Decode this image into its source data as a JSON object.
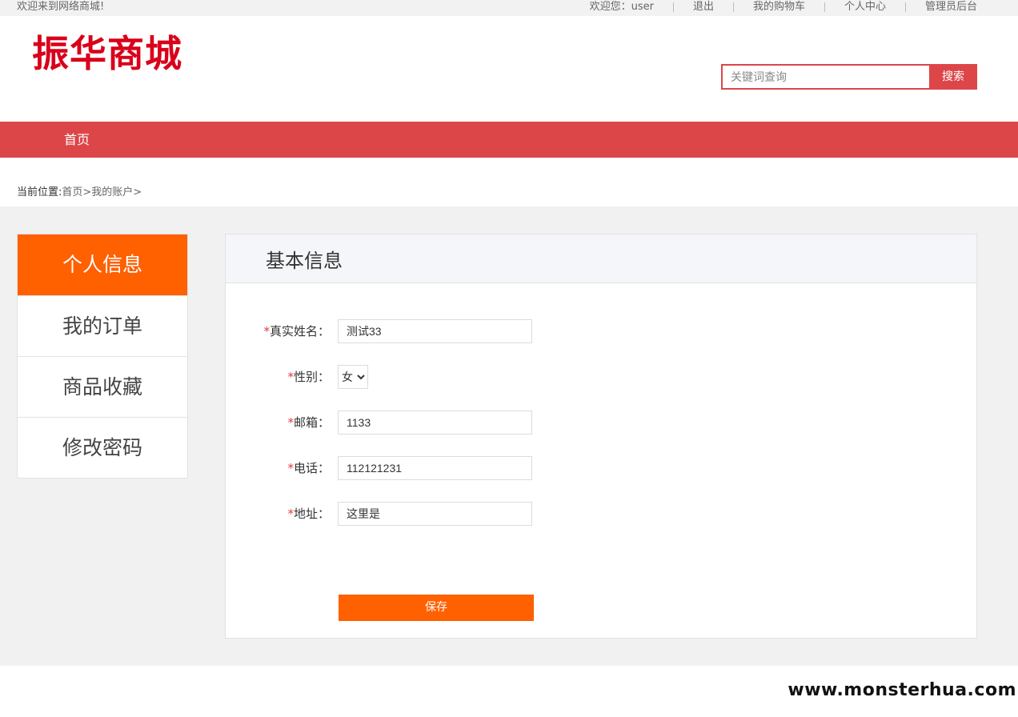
{
  "topbar": {
    "welcome": "欢迎来到网络商城!",
    "links": [
      "欢迎您：user",
      "退出",
      "我的购物车",
      "个人中心",
      "管理员后台"
    ]
  },
  "header": {
    "logo": "振华商城",
    "search_placeholder": "关键词查询",
    "search_button": "搜索"
  },
  "nav": {
    "items": [
      "首页"
    ]
  },
  "breadcrumb": {
    "label": "当前位置:",
    "path": "首页>我的账户>"
  },
  "sidebar": {
    "items": [
      {
        "label": "个人信息",
        "active": true
      },
      {
        "label": "我的订单",
        "active": false
      },
      {
        "label": "商品收藏",
        "active": false
      },
      {
        "label": "修改密码",
        "active": false
      }
    ]
  },
  "panel": {
    "title": "基本信息",
    "required_mark": "*",
    "fields": {
      "name": {
        "label": "真实姓名：",
        "value": "测试33"
      },
      "gender": {
        "label": "性别：",
        "value": "女",
        "options": [
          "女"
        ]
      },
      "email": {
        "label": "邮箱：",
        "value": "1133"
      },
      "phone": {
        "label": "电话：",
        "value": "112121231"
      },
      "address": {
        "label": "地址：",
        "value": "这里是"
      }
    },
    "save_label": "保存"
  },
  "watermark": "www.monsterhua.com",
  "colors": {
    "brand_red": "#dd4649",
    "accent_orange": "#ff6000",
    "logo_red": "#d9001b"
  }
}
